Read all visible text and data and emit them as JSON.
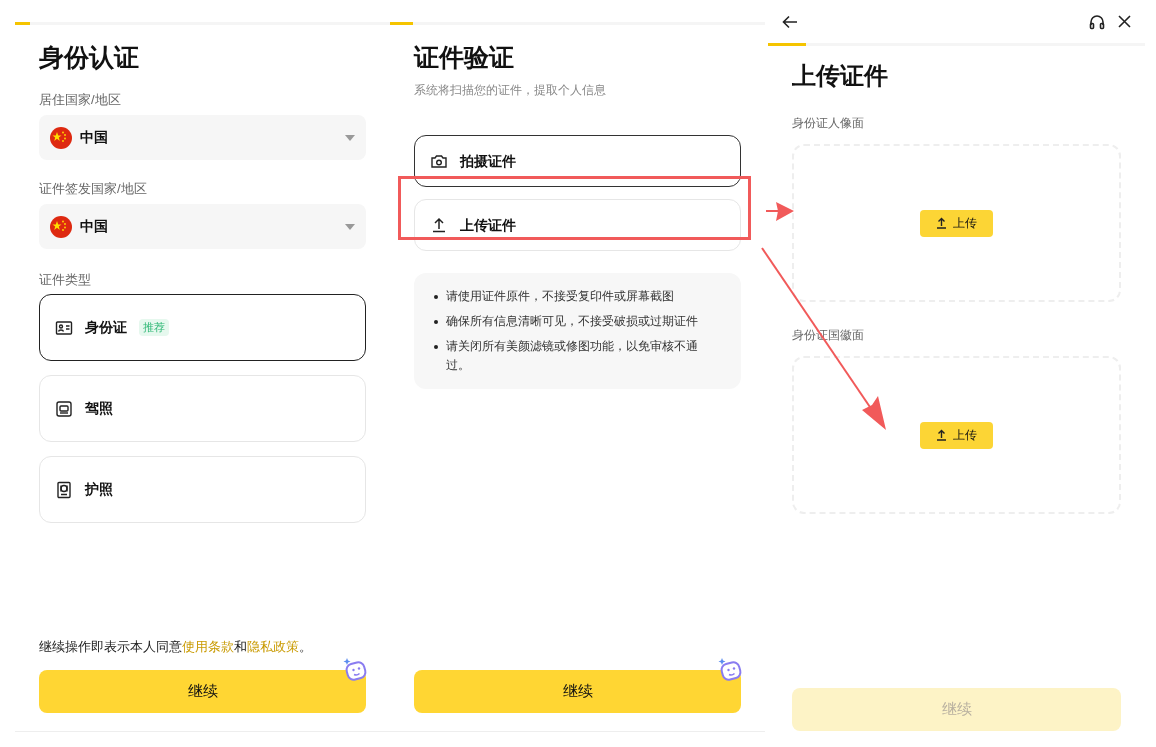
{
  "identity_page": {
    "progress": {
      "level": 0.04
    },
    "title": "身份认证",
    "fields": [
      {
        "label": "居住国家/地区",
        "value": "中国"
      },
      {
        "label": "证件签发国家/地区",
        "value": "中国"
      }
    ],
    "doc_type_label": "证件类型",
    "doc_types": [
      {
        "kind": "id_card",
        "label": "身份证",
        "badge": "推荐",
        "selected": true
      },
      {
        "kind": "license",
        "label": "驾照",
        "selected": false
      },
      {
        "kind": "passport",
        "label": "护照",
        "selected": false
      }
    ],
    "consent": [
      {
        "kind": "text",
        "text": "继续操作即表示本人同意"
      },
      {
        "kind": "link",
        "text": "使用条款"
      },
      {
        "kind": "text",
        "text": "和"
      },
      {
        "kind": "link",
        "text": "隐私政策"
      },
      {
        "kind": "text",
        "text": "。"
      }
    ],
    "continue_button": {
      "label": "继续",
      "disabled": false
    }
  },
  "verification_page": {
    "progress": {
      "level": 0.06
    },
    "title": "证件验证",
    "subtitle": "系统将扫描您的证件，提取个人信息",
    "options": [
      {
        "kind": "camera",
        "label": "拍摄证件",
        "selected": true
      },
      {
        "kind": "upload",
        "label": "上传证件",
        "selected": false
      }
    ],
    "tips": [
      "请使用证件原件，不接受复印件或屏幕截图",
      "确保所有信息清晰可见，不接受破损或过期证件",
      "请关闭所有美颜滤镜或修图功能，以免审核不通过。"
    ],
    "continue_button": {
      "label": "继续",
      "disabled": false
    }
  },
  "upload_page": {
    "progress": {
      "level": 0.1
    },
    "title": "上传证件",
    "slots": [
      {
        "label": "身份证人像面",
        "button": "上传"
      },
      {
        "label": "身份证国徽面",
        "button": "上传"
      }
    ],
    "continue_button": {
      "label": "继续",
      "disabled": true
    }
  }
}
